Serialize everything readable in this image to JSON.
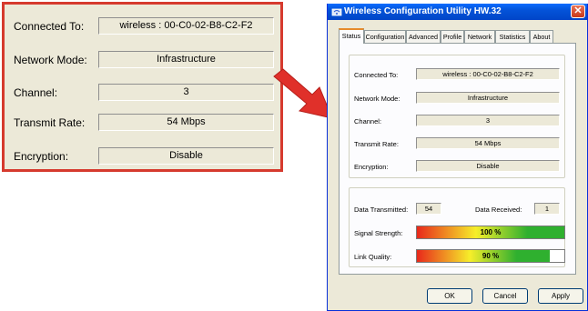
{
  "zoom_panel": {
    "rows": [
      {
        "label": "Connected To:",
        "value": "wireless : 00-C0-02-B8-C2-F2"
      },
      {
        "label": "Network Mode:",
        "value": "Infrastructure"
      },
      {
        "label": "Channel:",
        "value": "3"
      },
      {
        "label": "Transmit Rate:",
        "value": "54 Mbps"
      },
      {
        "label": "Encryption:",
        "value": "Disable"
      }
    ]
  },
  "window": {
    "title": "Wireless Configuration Utility HW.32",
    "close_glyph": "✕",
    "tabs": [
      "Status",
      "Configuration",
      "Advanced",
      "Profile",
      "Network",
      "Statistics",
      "About"
    ],
    "active_tab": "Status",
    "status": {
      "rows": [
        {
          "label": "Connected To:",
          "value": "wireless : 00-C0-02-B8-C2-F2"
        },
        {
          "label": "Network Mode:",
          "value": "Infrastructure"
        },
        {
          "label": "Channel:",
          "value": "3"
        },
        {
          "label": "Transmit Rate:",
          "value": "54 Mbps"
        },
        {
          "label": "Encryption:",
          "value": "Disable"
        }
      ],
      "data_transmitted_label": "Data Transmitted:",
      "data_transmitted_value": "54",
      "data_received_label": "Data Received:",
      "data_received_value": "1",
      "signal_strength_label": "Signal Strength:",
      "signal_strength_text": "100 %",
      "signal_strength_percent": 100,
      "link_quality_label": "Link Quality:",
      "link_quality_text": "90 %",
      "link_quality_percent": 90
    },
    "buttons": {
      "ok": "OK",
      "cancel": "Cancel",
      "apply": "Apply"
    }
  },
  "colors": {
    "callout_border": "#d63a2e",
    "title_bar": "#0453d8",
    "active_tab_accent": "#e68b2c"
  },
  "icons": {
    "title": "wireless-icon",
    "arrow": "arrow-right-down-icon"
  }
}
